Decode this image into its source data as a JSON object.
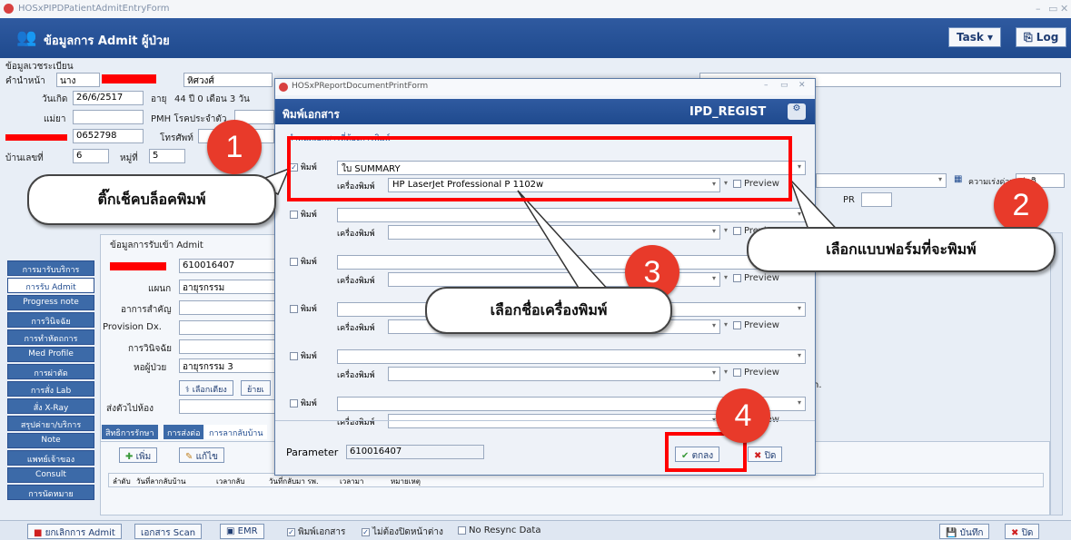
{
  "window": {
    "title": "HOSxPIPDPatientAdmitEntryForm"
  },
  "header": {
    "title": "ข้อมูลการ Admit ผู้ป่วย",
    "task_label": "Task",
    "log_label": "Log"
  },
  "registration": {
    "section": "ข้อมูลเวชระเบียน",
    "prefix_label": "คำนำหน้า",
    "prefix_value": "นาง",
    "surname_value": "หิศวงศ์",
    "birth_label": "วันเกิด",
    "birth_value": "26/6/2517",
    "age_label": "อายุ",
    "age_value": "44 ปี 0 เดือน 3 วัน",
    "mother_label": "แม่ยา",
    "pmh_label": "PMH โรคประจำตัว",
    "hn_value": "0652798",
    "phone_label": "โทรศัพท์",
    "house_label": "บ้านเลขที่",
    "house_value": "6",
    "moo_label": "หมู่ที่",
    "moo_value": "5",
    "pr_label": "PR"
  },
  "sidebar": {
    "items": [
      "การมารับบริการ",
      "การรับ Admit",
      "Progress note",
      "การวินิจฉัย",
      "การทำหัตถการ",
      "Med Profile",
      "การผ่าตัด",
      "การสั่ง Lab",
      "สั่ง X-Ray",
      "สรุปค่ายา/บริการ",
      "Note",
      "แพทย์เจ้าของ",
      "Consult",
      "การนัดหมาย"
    ]
  },
  "admit": {
    "section": "ข้อมูลการรับเข้า Admit",
    "an_value": "610016407",
    "dept_label": "แผนก",
    "dept_value": "อายุรกรรม",
    "cc_label": "อาการสำคัญ",
    "provision_label": "Provision Dx.",
    "dx_label": "การวินิจฉัย",
    "ward_label": "หอผู้ป่วย",
    "ward_value": "อายุรกรรม 3",
    "bed_button": "เลือกเตียง",
    "move_button": "ย้ายเ",
    "sendto_label": "ส่งตัวไปห้อง",
    "tabs": [
      "สิทธิการรักษา",
      "การส่งต่อ",
      "การลากลับบ้าน"
    ],
    "add_button": "เพิ่ม",
    "edit_button": "แก้ไข",
    "grid_headers": [
      "ลำดับ",
      "วันที่ลากลับบ้าน",
      "เวลากลับ",
      "วันที่กลับมา รพ.",
      "เวลามา",
      "หมายเหตุ"
    ]
  },
  "dialog": {
    "title": "HOSxPReportDocumentPrintForm",
    "heading": "พิมพ์เอกสาร",
    "code": "IPD_REGIST",
    "group_label": "กำหนดเอกสารที่ต้องการพิมพ์",
    "print_label": "พิมพ์",
    "printer_label": "เครื่องพิมพ์",
    "preview_label": "Preview",
    "rows": [
      {
        "checked": true,
        "document": "ใบ SUMMARY",
        "printer": "HP LaserJet Professional P 1102w"
      },
      {
        "checked": false,
        "document": "",
        "printer": ""
      },
      {
        "checked": false,
        "document": "",
        "printer": ""
      },
      {
        "checked": false,
        "document": "",
        "printer": ""
      },
      {
        "checked": false,
        "document": "",
        "printer": ""
      },
      {
        "checked": false,
        "document": "",
        "printer": ""
      }
    ],
    "parameter_label": "Parameter",
    "parameter_value": "610016407",
    "ok_label": "ตกลง",
    "close_label": "ปิด"
  },
  "right": {
    "gap_label": "ความเร่งด่วน",
    "gap_value": "ปกติ",
    "n_text": "n."
  },
  "bottombar": {
    "cancel_admit": "ยกเลิกการ Admit",
    "scan": "เอกสาร Scan",
    "emr": "EMR",
    "print_doc": "พิมพ์เอกสาร",
    "no_close": "ไม่ต้องปิดหน้าต่าง",
    "no_resync": "No Resync Data",
    "save": "บันทึก",
    "close": "ปิด"
  },
  "annotations": {
    "step1": "1",
    "step2": "2",
    "step3": "3",
    "step4": "4",
    "bubble1": "ติ๊กเช็คบล็อคพิมพ์",
    "bubble2": "เลือกแบบฟอร์มที่จะพิมพ์",
    "bubble3": "เลือกชื่อเครื่องพิมพ์",
    "accent": "#e83a2a"
  }
}
